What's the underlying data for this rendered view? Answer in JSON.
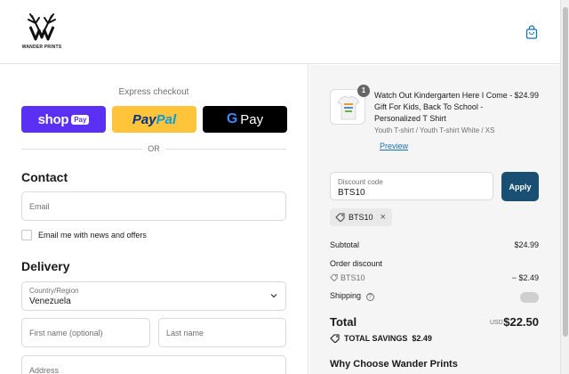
{
  "header": {
    "brand_text": "WANDER PRINTS",
    "logo_icon": "deer-antler-logo-icon",
    "cart_icon": "shopping-bag-icon"
  },
  "express": {
    "label": "Express checkout",
    "shop_pay": {
      "word": "shop",
      "pill": "Pay"
    },
    "paypal": {
      "part1": "Pay",
      "part2": "Pal"
    },
    "gpay": {
      "g": "G",
      "word": "Pay"
    },
    "or": "OR"
  },
  "contact": {
    "title": "Contact",
    "email_placeholder": "Email",
    "newsletter_label": "Email me with news and offers"
  },
  "delivery": {
    "title": "Delivery",
    "country_label": "Country/Region",
    "country_value": "Venezuela",
    "first_name_placeholder": "First name (optional)",
    "last_name_placeholder": "Last name",
    "address_placeholder": "Address"
  },
  "order": {
    "quantity": "1",
    "product_title": "Watch Out Kindergarten Here I Come - Gift For Kids, Back To School - Personalized T Shirt",
    "product_price": "$24.99",
    "variant": "Youth T-shirt / Youth T-shirt White / XS",
    "preview_link": "Preview",
    "discount_label": "Discount code",
    "discount_value": "BTS10",
    "apply_label": "Apply",
    "applied_code": "BTS10",
    "remove_icon": "×",
    "subtotal_label": "Subtotal",
    "subtotal_value": "$24.99",
    "order_discount_label": "Order discount",
    "discount_code_row": "BTS10",
    "discount_amount": "− $2.49",
    "shipping_label": "Shipping",
    "shipping_help_icon": "?",
    "total_label": "Total",
    "currency": "USD",
    "total_value": "$22.50",
    "savings_label": "TOTAL SAVINGS",
    "savings_value": "$2.49",
    "why_heading": "Why Choose Wander Prints"
  },
  "colors": {
    "shop_pay": "#5a31f4",
    "paypal": "#ffc439",
    "gpay": "#000000",
    "apply": "#1a4f74",
    "link": "#1773b0"
  }
}
